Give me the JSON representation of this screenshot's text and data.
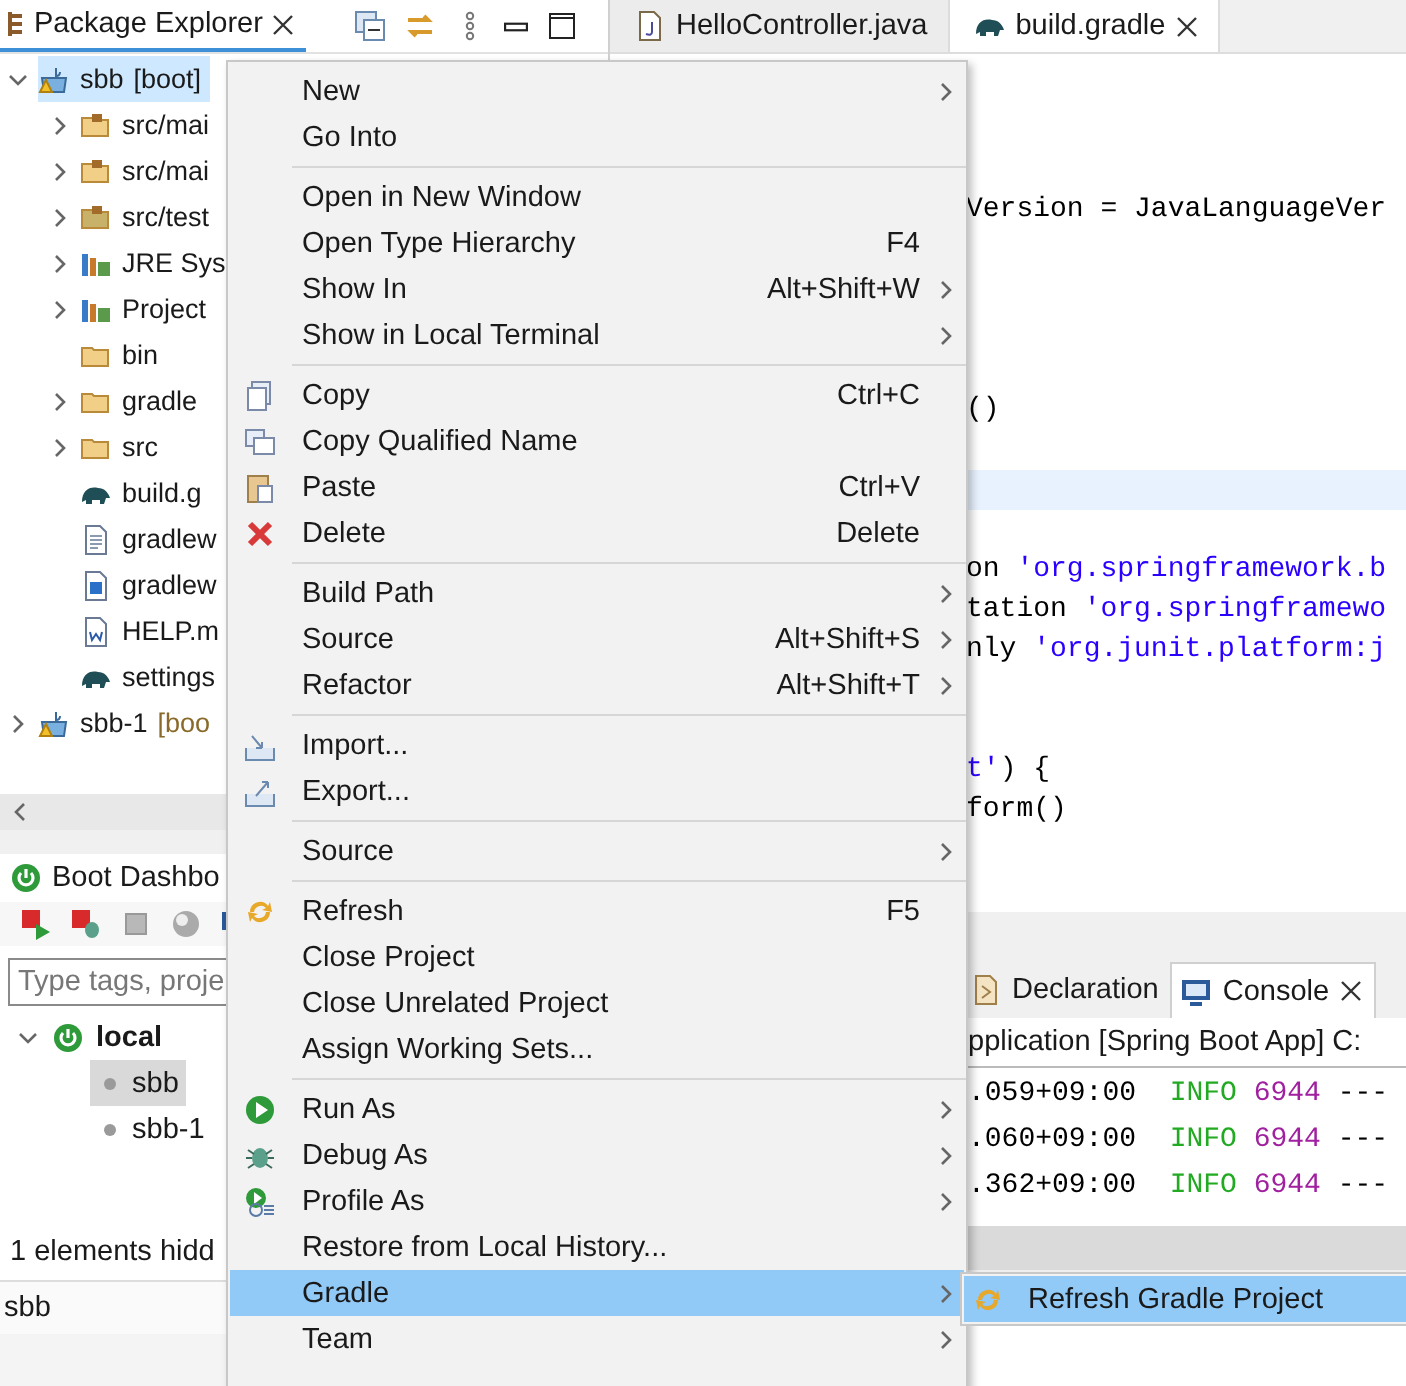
{
  "package_explorer": {
    "title": "Package Explorer",
    "tree": [
      {
        "label": "sbb",
        "tag": "[boot]",
        "kind": "project",
        "expanded": true,
        "selected": true,
        "children": [
          {
            "label": "src/mai",
            "kind": "source-folder",
            "expanded": false,
            "selected": false
          },
          {
            "label": "src/mai",
            "kind": "source-folder",
            "expanded": false,
            "selected": false
          },
          {
            "label": "src/test",
            "kind": "test-folder",
            "expanded": false,
            "selected": false
          },
          {
            "label": "JRE Sys",
            "kind": "library",
            "expanded": false,
            "selected": false
          },
          {
            "label": "Project",
            "kind": "library",
            "expanded": false,
            "selected": false
          },
          {
            "label": "bin",
            "kind": "folder",
            "selected": false
          },
          {
            "label": "gradle",
            "kind": "folder",
            "expanded": false,
            "selected": false
          },
          {
            "label": "src",
            "kind": "folder",
            "expanded": false,
            "selected": false
          },
          {
            "label": "build.g",
            "kind": "gradle",
            "selected": false
          },
          {
            "label": "gradlew",
            "kind": "text-file",
            "selected": false
          },
          {
            "label": "gradlew",
            "kind": "script-file",
            "selected": false
          },
          {
            "label": "HELP.m",
            "kind": "doc-file",
            "selected": false
          },
          {
            "label": "settings",
            "kind": "gradle",
            "selected": false
          }
        ]
      },
      {
        "label": "sbb-1",
        "tag": "[boo",
        "kind": "project",
        "expanded": false,
        "selected": false
      }
    ]
  },
  "editor": {
    "tabs": [
      {
        "label": "HelloController.java",
        "selected": false
      },
      {
        "label": "build.gradle",
        "selected": true
      }
    ],
    "lines": [
      {
        "current": false
      },
      {
        "current": false
      },
      {
        "current": false
      },
      {
        "current": false,
        "segments": [
          {
            "text": "Version = JavaLanguageVer",
            "kind": "plain"
          }
        ]
      },
      {
        "current": false
      },
      {
        "current": false
      },
      {
        "current": false
      },
      {
        "current": false
      },
      {
        "current": false,
        "segments": [
          {
            "text": "()",
            "kind": "plain"
          }
        ]
      },
      {
        "current": false
      },
      {
        "current": true
      },
      {
        "current": false
      },
      {
        "current": false,
        "segments": [
          {
            "text": "on ",
            "kind": "plain"
          },
          {
            "text": "'org.springframework.b",
            "kind": "string"
          }
        ]
      },
      {
        "current": false,
        "segments": [
          {
            "text": "tation ",
            "kind": "plain"
          },
          {
            "text": "'org.springframewo",
            "kind": "string"
          }
        ]
      },
      {
        "current": false,
        "segments": [
          {
            "text": "nly ",
            "kind": "plain"
          },
          {
            "text": "'org.junit.platform:j",
            "kind": "string"
          }
        ]
      },
      {
        "current": false
      },
      {
        "current": false
      },
      {
        "current": false,
        "segments": [
          {
            "text": "t'",
            "kind": "string"
          },
          {
            "text": ") {",
            "kind": "plain"
          }
        ]
      },
      {
        "current": false,
        "segments": [
          {
            "text": "form()",
            "kind": "plain"
          }
        ]
      }
    ]
  },
  "console": {
    "tabs": [
      {
        "label": "Declaration",
        "selected": false
      },
      {
        "label": "Console",
        "selected": true
      }
    ],
    "header": "pplication [Spring Boot App] C:",
    "lines": [
      {
        "time": ".059+09:00",
        "level": "INFO",
        "pid": "6944",
        "rest": "---"
      },
      {
        "time": ".060+09:00",
        "level": "INFO",
        "pid": "6944",
        "rest": "---"
      },
      {
        "time": ".362+09:00",
        "level": "INFO",
        "pid": "6944",
        "rest": "---"
      }
    ]
  },
  "boot_dashboard": {
    "title": "Boot Dashbo",
    "search": {
      "placeholder": "Type tags, proje"
    },
    "tree": [
      {
        "label": "local",
        "expanded": true,
        "children": [
          {
            "label": "sbb",
            "selected": true
          },
          {
            "label": "sbb-1",
            "selected": false
          }
        ]
      }
    ],
    "footer": "1 elements hidd"
  },
  "status_bar": {
    "text": "sbb"
  },
  "context_menu": {
    "items": [
      {
        "kind": "item",
        "label": "New",
        "submenu": true,
        "selected": false
      },
      {
        "kind": "item",
        "label": "Go Into",
        "submenu": false,
        "selected": false
      },
      {
        "kind": "separator"
      },
      {
        "kind": "item",
        "label": "Open in New Window",
        "submenu": false,
        "selected": false
      },
      {
        "kind": "item",
        "label": "Open Type Hierarchy",
        "shortcut": "F4",
        "submenu": false,
        "selected": false
      },
      {
        "kind": "item",
        "label": "Show In",
        "shortcut": "Alt+Shift+W",
        "submenu": true,
        "selected": false
      },
      {
        "kind": "item",
        "label": "Show in Local Terminal",
        "submenu": true,
        "selected": false
      },
      {
        "kind": "separator"
      },
      {
        "kind": "item",
        "label": "Copy",
        "shortcut": "Ctrl+C",
        "submenu": false,
        "selected": false
      },
      {
        "kind": "item",
        "label": "Copy Qualified Name",
        "submenu": false,
        "selected": false
      },
      {
        "kind": "item",
        "label": "Paste",
        "shortcut": "Ctrl+V",
        "submenu": false,
        "selected": false
      },
      {
        "kind": "item",
        "label": "Delete",
        "shortcut": "Delete",
        "submenu": false,
        "selected": false
      },
      {
        "kind": "separator"
      },
      {
        "kind": "item",
        "label": "Build Path",
        "submenu": true,
        "selected": false
      },
      {
        "kind": "item",
        "label": "Source",
        "shortcut": "Alt+Shift+S",
        "submenu": true,
        "selected": false
      },
      {
        "kind": "item",
        "label": "Refactor",
        "shortcut": "Alt+Shift+T",
        "submenu": true,
        "selected": false
      },
      {
        "kind": "separator"
      },
      {
        "kind": "item",
        "label": "Import...",
        "submenu": false,
        "selected": false
      },
      {
        "kind": "item",
        "label": "Export...",
        "submenu": false,
        "selected": false
      },
      {
        "kind": "separator"
      },
      {
        "kind": "item",
        "label": "Source",
        "submenu": true,
        "selected": false
      },
      {
        "kind": "separator"
      },
      {
        "kind": "item",
        "label": "Refresh",
        "shortcut": "F5",
        "submenu": false,
        "selected": false
      },
      {
        "kind": "item",
        "label": "Close Project",
        "submenu": false,
        "selected": false
      },
      {
        "kind": "item",
        "label": "Close Unrelated Project",
        "submenu": false,
        "selected": false
      },
      {
        "kind": "item",
        "label": "Assign Working Sets...",
        "submenu": false,
        "selected": false
      },
      {
        "kind": "separator"
      },
      {
        "kind": "item",
        "label": "Run As",
        "submenu": true,
        "selected": false
      },
      {
        "kind": "item",
        "label": "Debug As",
        "submenu": true,
        "selected": false
      },
      {
        "kind": "item",
        "label": "Profile As",
        "submenu": true,
        "selected": false
      },
      {
        "kind": "item",
        "label": "Restore from Local History...",
        "submenu": false,
        "selected": false
      },
      {
        "kind": "item",
        "label": "Gradle",
        "submenu": true,
        "selected": true
      },
      {
        "kind": "item",
        "label": "Team",
        "submenu": true,
        "selected": false
      }
    ]
  },
  "submenu": {
    "items": [
      {
        "label": "Refresh Gradle Project",
        "selected": true
      }
    ]
  }
}
